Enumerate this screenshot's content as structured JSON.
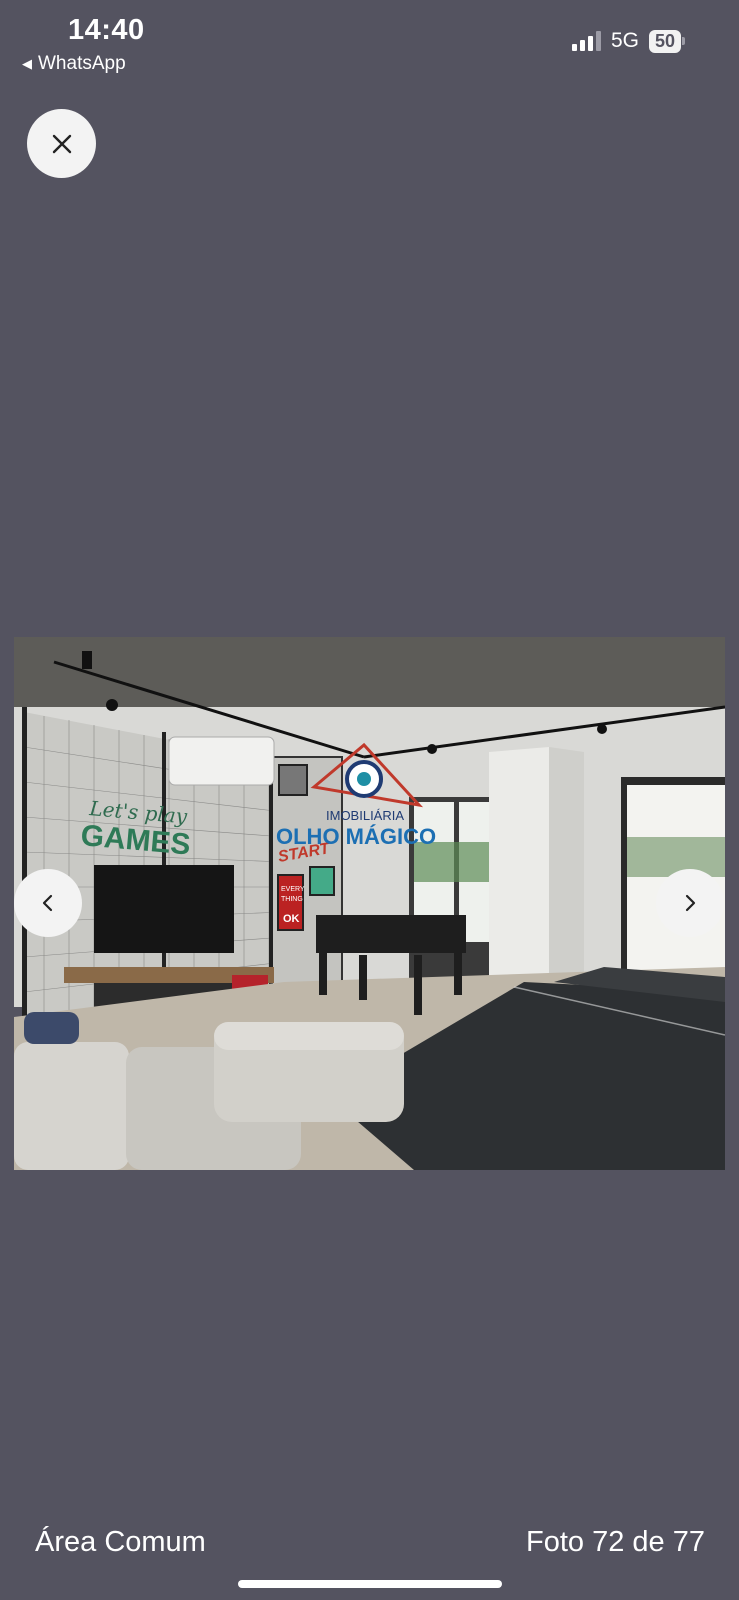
{
  "status_bar": {
    "time": "14:40",
    "back_app": "WhatsApp",
    "network": "5G",
    "battery": "50"
  },
  "viewer": {
    "caption": "Área Comum",
    "counter": "Foto 72 de 77"
  },
  "photo": {
    "wall_text_1": "Let's play",
    "wall_text_2": "GAMES",
    "sign_start": "START",
    "poster_text_1": "EVERY",
    "poster_text_2": "THING",
    "poster_text_3": "OK",
    "watermark_line1": "IMOBILIÁRIA",
    "watermark_line2": "OLHO MÁGICO"
  },
  "icons": {
    "close": "close-icon",
    "prev": "chevron-left-icon",
    "next": "chevron-right-icon",
    "back": "back-triangle-icon"
  }
}
